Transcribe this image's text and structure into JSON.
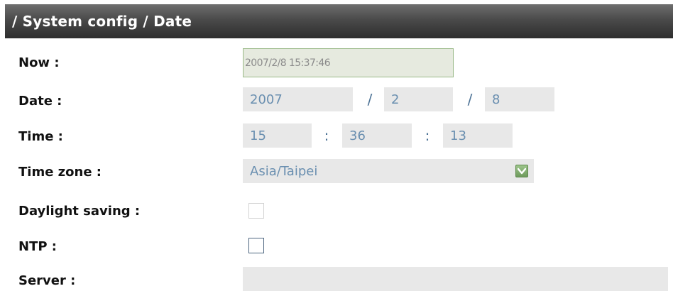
{
  "header": {
    "title": "/ System config / Date"
  },
  "labels": {
    "now": "Now :",
    "date": "Date :",
    "time": "Time :",
    "timezone": "Time zone :",
    "daylight": "Daylight saving :",
    "ntp": "NTP :",
    "server": "Server :"
  },
  "now_value": "2007/2/8 15:37:46",
  "date": {
    "year": "2007",
    "month": "2",
    "day": "8",
    "separator": "/"
  },
  "time": {
    "hour": "15",
    "minute": "36",
    "second": "13",
    "separator": ":"
  },
  "timezone": {
    "selected": "Asia/Taipei"
  },
  "daylight_saving": {
    "checked": false
  },
  "ntp": {
    "checked": false
  },
  "server": {
    "value": ""
  },
  "icons": {
    "dropdown": "chevron-down-icon"
  },
  "colors": {
    "header": "#4a4a4a",
    "field_bg": "#e8e8e8",
    "field_text": "#6a8fb0",
    "now_border": "#9aba88"
  }
}
